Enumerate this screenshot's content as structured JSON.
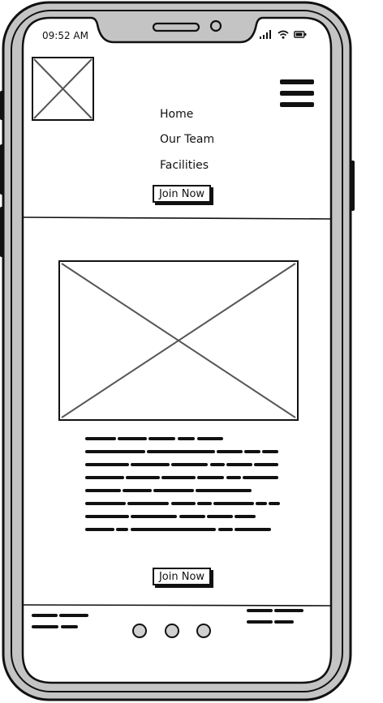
{
  "status_bar": {
    "time": "09:52 AM",
    "icons": [
      "signal-icon",
      "wifi-icon",
      "battery-icon"
    ]
  },
  "header": {
    "logo_icon": "image-placeholder-icon",
    "menu_icon": "hamburger-menu-icon",
    "nav": [
      {
        "label": "Home"
      },
      {
        "label": "Our Team"
      },
      {
        "label": "Facilities"
      }
    ],
    "join_label": "Join Now"
  },
  "main": {
    "hero_icon": "image-placeholder-icon",
    "paragraph_note": "scribbled placeholder text",
    "join_label": "Join Now"
  },
  "footer": {
    "carousel_dots": 3
  }
}
